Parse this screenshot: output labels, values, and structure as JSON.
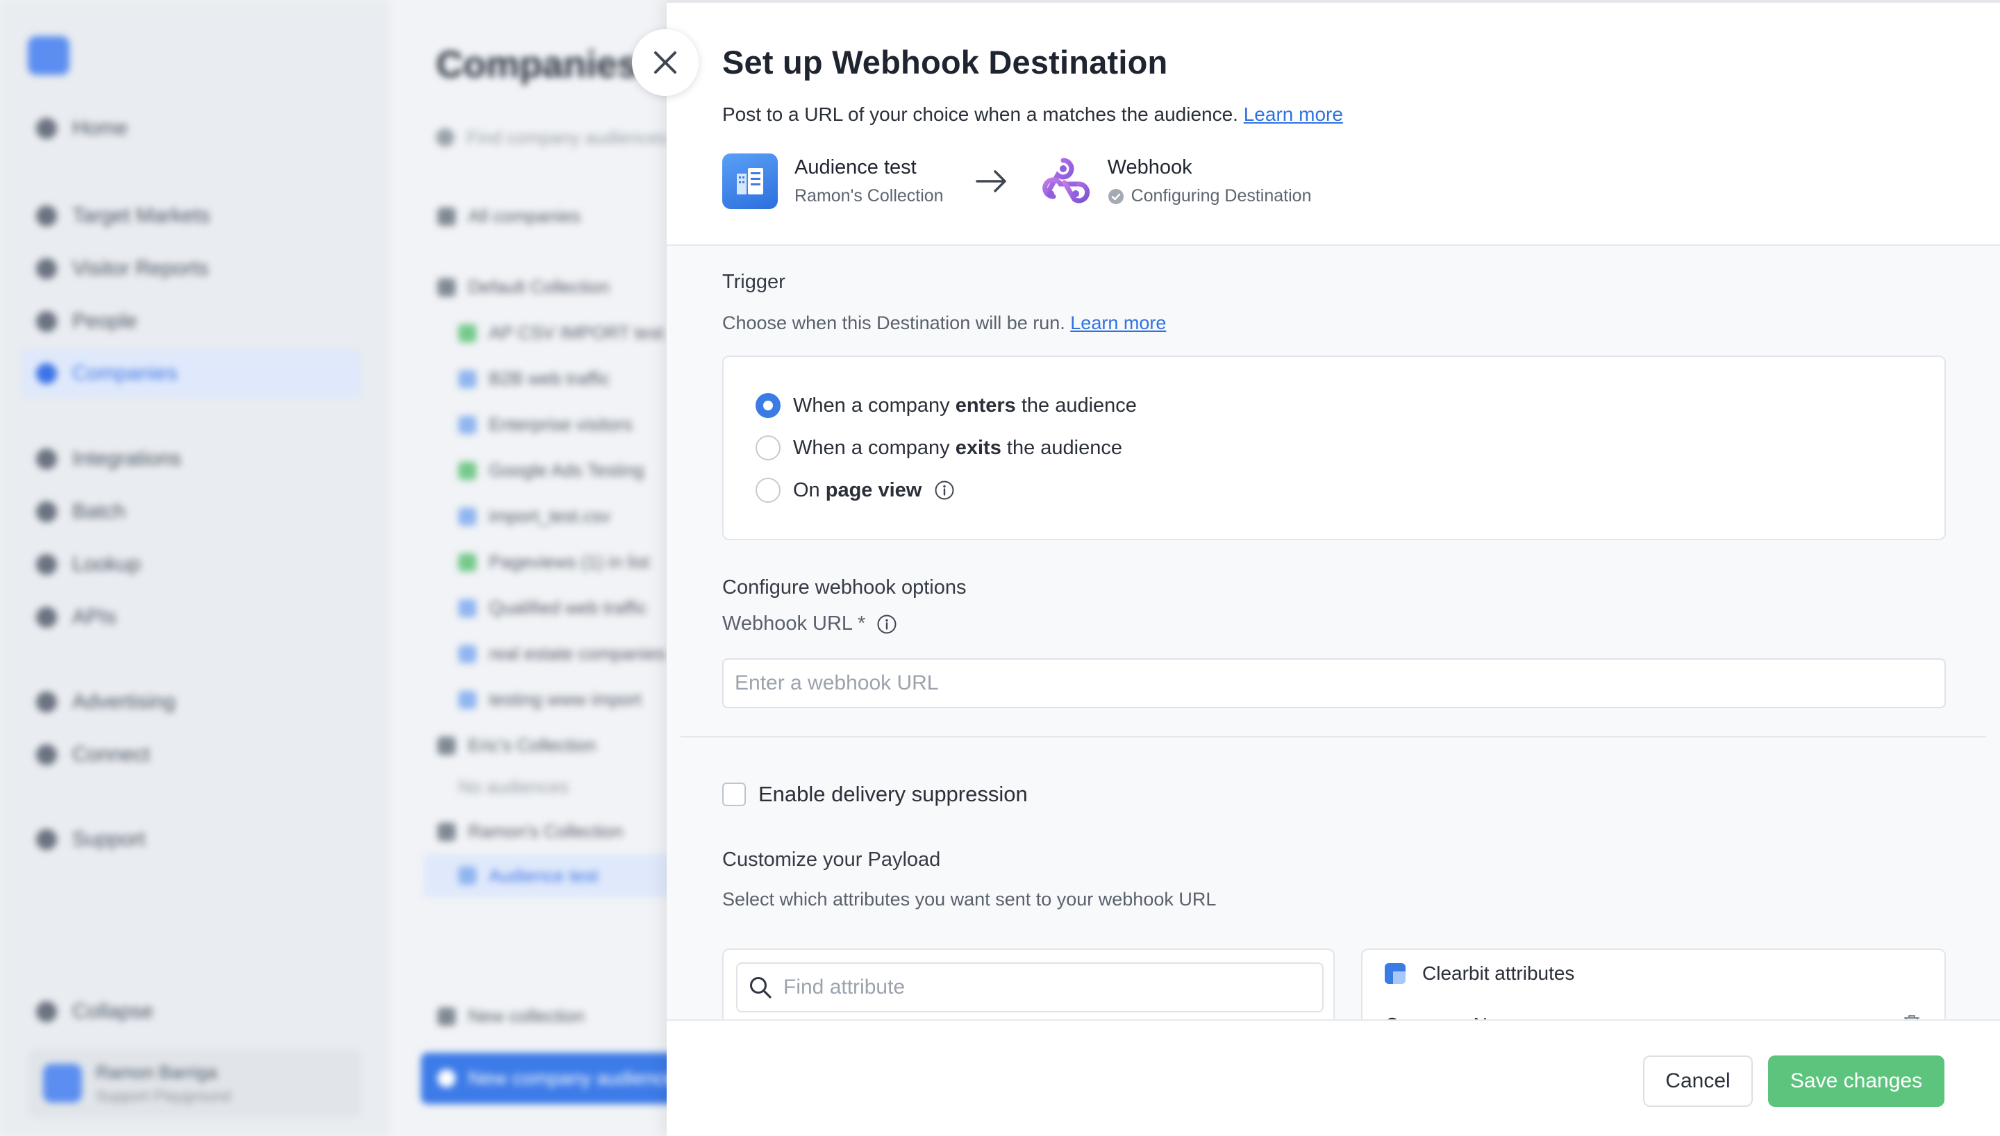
{
  "background": {
    "sidebar": {
      "nav": [
        "Home",
        "Target Markets",
        "Visitor Reports",
        "People",
        "Companies",
        "Integrations",
        "Batch",
        "Lookup",
        "APIs",
        "Advertising",
        "Connect",
        "Support",
        "Collapse"
      ],
      "user_name": "Ramon Barriga",
      "user_org": "Support Playground"
    },
    "main": {
      "title": "Companies",
      "search_placeholder": "Find company audiences",
      "all_companies": "All companies",
      "collections": [
        {
          "name": "Default Collection",
          "items": [
            "AP CSV IMPORT test",
            "B2B web traffic",
            "Enterprise visitors",
            "Google Ads Testing",
            "import_test.csv",
            "Pageviews (1) in list",
            "Qualified web traffic",
            "real estate companies",
            "testing www import"
          ]
        },
        {
          "name": "Eric's Collection",
          "items": [
            "No audiences"
          ]
        },
        {
          "name": "Ramon's Collection",
          "items": [
            "Audience test"
          ]
        }
      ],
      "new_collection": "New collection",
      "new_audience_button": "New company audience"
    }
  },
  "panel": {
    "title": "Set up Webhook Destination",
    "subtitle": "Post to a URL of your choice when a matches the audience.",
    "learn_more": "Learn more",
    "source": {
      "name": "Audience test",
      "collection": "Ramon's Collection"
    },
    "destination": {
      "name": "Webhook",
      "status": "Configuring Destination"
    },
    "trigger": {
      "title": "Trigger",
      "description": "Choose when this Destination will be run.",
      "learn_more": "Learn more",
      "options": [
        {
          "pre": "When a company ",
          "bold": "enters",
          "post": " the audience",
          "checked": true
        },
        {
          "pre": "When a company ",
          "bold": "exits",
          "post": " the audience",
          "checked": false
        },
        {
          "pre": "On ",
          "bold": "page view",
          "post": "",
          "checked": false
        }
      ]
    },
    "webhook": {
      "section_title": "Configure webhook options",
      "url_label": "Webhook URL *",
      "url_placeholder": "Enter a webhook URL",
      "url_value": ""
    },
    "suppression_label": "Enable delivery suppression",
    "payload": {
      "title": "Customize your Payload",
      "description": "Select which attributes you want sent to your webhook URL",
      "find_placeholder": "Find attribute",
      "attributes_title": "Clearbit attributes",
      "attributes": [
        "Company Name"
      ]
    },
    "footer": {
      "cancel": "Cancel",
      "save": "Save changes"
    }
  }
}
